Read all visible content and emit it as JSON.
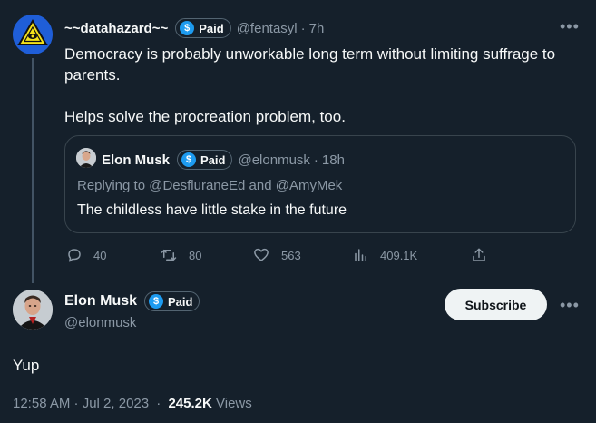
{
  "tweet": {
    "author": {
      "display_name": "~~datahazard~~",
      "badge": "Paid",
      "handle": "@fentasyl",
      "time": "7h"
    },
    "text_lines": [
      "Democracy is probably unworkable long term without limiting suffrage to parents.",
      "Helps solve the procreation problem, too."
    ],
    "quote": {
      "display_name": "Elon Musk",
      "badge": "Paid",
      "handle": "@elonmusk",
      "time": "18h",
      "replying_prefix": "Replying to",
      "replying_user1": "@DesfluraneEd",
      "replying_and": "and",
      "replying_user2": "@AmyMek",
      "text": "The childless have little stake in the future"
    },
    "actions": {
      "replies": "40",
      "retweets": "80",
      "likes": "563",
      "views": "409.1K"
    }
  },
  "reply": {
    "display_name": "Elon Musk",
    "badge": "Paid",
    "handle": "@elonmusk",
    "subscribe_label": "Subscribe",
    "text": "Yup",
    "timestamp": "12:58 AM · Jul 2, 2023",
    "views_count": "245.2K",
    "views_label": "Views"
  },
  "icons": {
    "badge": "verified-dollar-icon",
    "reply": "reply-icon",
    "retweet": "retweet-icon",
    "like": "heart-icon",
    "views": "views-chart-icon",
    "share": "share-icon",
    "more": "more-icon"
  },
  "colors": {
    "background": "#15202b",
    "accent": "#1d9bf0",
    "muted_text": "#8b98a5",
    "primary_text": "#f7f9f9",
    "subscribe_bg": "#eff3f4"
  }
}
